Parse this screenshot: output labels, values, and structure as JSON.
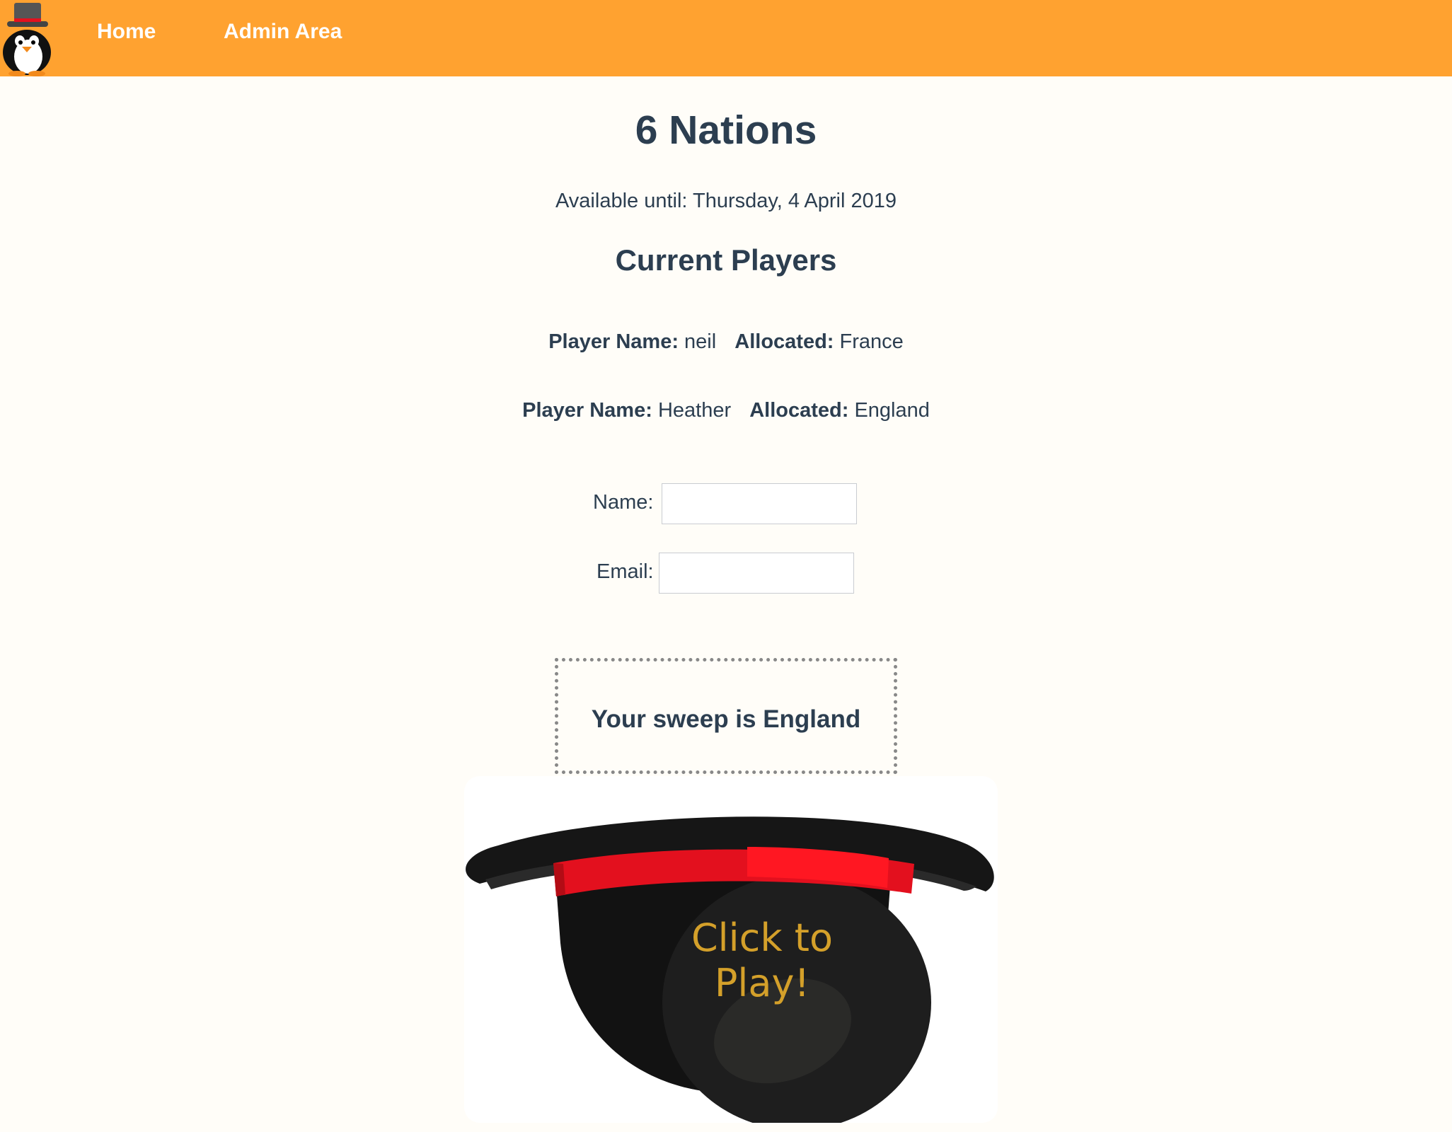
{
  "nav": {
    "logo": "penguin-top-hat-logo",
    "home_label": "Home",
    "admin_label": "Admin Area"
  },
  "page": {
    "title": "6 Nations",
    "available_until": "Available until: Thursday, 4 April 2019",
    "players_heading": "Current Players"
  },
  "players": [
    {
      "name_label": "Player Name:",
      "name": "neil",
      "allocated_label": "Allocated:",
      "allocated": "France"
    },
    {
      "name_label": "Player Name:",
      "name": "Heather",
      "allocated_label": "Allocated:",
      "allocated": "England"
    }
  ],
  "form": {
    "name_label": "Name:",
    "name_value": "",
    "email_label": "Email:",
    "email_value": ""
  },
  "result": {
    "text": "Your sweep is England"
  },
  "hat": {
    "line1": "Click to",
    "line2": "Play!",
    "icon": "top-hat-icon"
  },
  "colors": {
    "navbar": "#ffa230",
    "text": "#2c3e50",
    "hat_text": "#d4a02a",
    "hat_band": "#e3101e"
  }
}
